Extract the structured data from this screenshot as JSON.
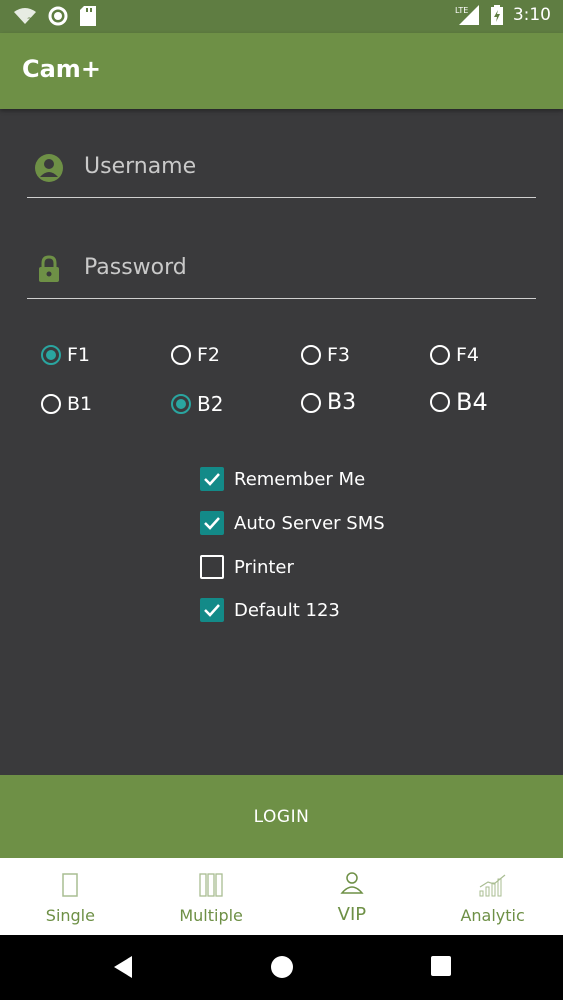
{
  "status": {
    "time": "3:10",
    "network_label": "LTE"
  },
  "app": {
    "title": "Cam+"
  },
  "form": {
    "username_placeholder": "Username",
    "password_placeholder": "Password"
  },
  "radios": [
    {
      "label": "F1",
      "checked": true
    },
    {
      "label": "F2",
      "checked": false
    },
    {
      "label": "F3",
      "checked": false
    },
    {
      "label": "F4",
      "checked": false
    },
    {
      "label": "B1",
      "checked": false
    },
    {
      "label": "B2",
      "checked": true
    },
    {
      "label": "B3",
      "checked": false
    },
    {
      "label": "B4",
      "checked": false
    }
  ],
  "checkboxes": [
    {
      "label": "Remember Me",
      "checked": true
    },
    {
      "label": "Auto Server SMS",
      "checked": true
    },
    {
      "label": "Printer",
      "checked": false
    },
    {
      "label": "Default 123",
      "checked": true
    }
  ],
  "login_label": "LOGIN",
  "tabs": [
    {
      "label": "Single",
      "icon": "single-icon"
    },
    {
      "label": "Multiple",
      "icon": "multiple-icon"
    },
    {
      "label": "VIP",
      "icon": "vip-icon"
    },
    {
      "label": "Analytic",
      "icon": "analytic-icon"
    }
  ],
  "colors": {
    "primary": "#6e9046",
    "accent": "#138a88",
    "background": "#3a3a3c"
  }
}
